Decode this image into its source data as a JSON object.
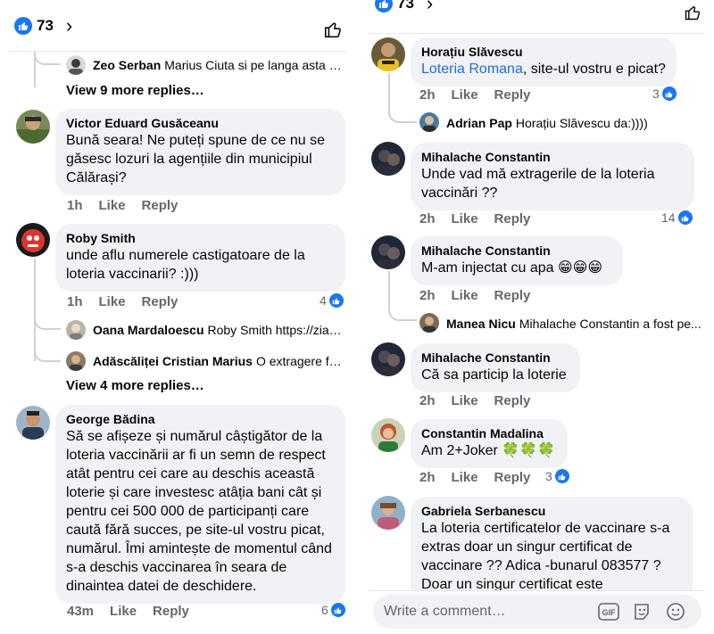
{
  "left": {
    "header": {
      "reaction_count": "73"
    },
    "threads": {
      "top_reply": {
        "author": "Zeo Serban",
        "text": "Marius Ciuta si pe langa asta fi..."
      },
      "top_view_more": "View 9 more replies…"
    },
    "comments": [
      {
        "author": "Victor Eduard Gusăceanu",
        "text": "Bună seara! Ne puteți spune de ce nu se găsesc lozuri la agențiile din municipiul Călărași?",
        "time": "1h",
        "like": "Like",
        "reply": "Reply"
      },
      {
        "author": "Roby Smith",
        "text": "unde aflu numerele castigatoare de la loteria vaccinarii? :)))",
        "time": "1h",
        "like": "Like",
        "reply": "Reply",
        "reactions": "4",
        "replies": [
          {
            "author": "Oana Mardaloescu",
            "text": "Roby Smith https://ziar..."
          },
          {
            "author": "Adăscăliței Cristian Marius",
            "text": "O extragere fa..."
          }
        ],
        "view_more": "View 4 more replies…"
      },
      {
        "author": "George Bădina",
        "text": "Să se afișeze și numărul câștigător de la loteria vaccinării ar fi un semn de respect atât pentru cei care au deschis această loterie și care investesc atâția bani cât și pentru cei 500 000 de participanți care caută fără succes, pe site-ul vostru picat, numărul. Îmi amintește de momentul când s-a deschis vaccinarea în seara de dinaintea datei de deschidere.",
        "time": "43m",
        "like": "Like",
        "reply": "Reply",
        "reactions": "6"
      }
    ]
  },
  "right": {
    "header": {
      "reaction_count": "73"
    },
    "comments": [
      {
        "author": "Horațiu Slăvescu",
        "link_text": "Loteria Romana",
        "text": ", site-ul vostru e picat?",
        "time": "2h",
        "like": "Like",
        "reply": "Reply",
        "reactions": "3",
        "replies": [
          {
            "author": "Adrian Pap",
            "text": "Horațiu Slăvescu da:))))"
          }
        ]
      },
      {
        "author": "Mihalache Constantin",
        "text": "Unde vad mă extragerile de la loteria vaccinări ??",
        "time": "2h",
        "like": "Like",
        "reply": "Reply",
        "reactions": "14"
      },
      {
        "author": "Mihalache Constantin",
        "text": "M-am injectat cu apa 😁😁😁",
        "time": "2h",
        "like": "Like",
        "reply": "Reply",
        "replies": [
          {
            "author": "Manea Nicu",
            "text": "Mihalache Constantin a fost pe..."
          }
        ]
      },
      {
        "author": "Mihalache Constantin",
        "text": "Că sa particip la loterie",
        "time": "2h",
        "like": "Like",
        "reply": "Reply"
      },
      {
        "author": "Constantin Madalina",
        "text": "Am 2+Joker 🍀🍀🍀",
        "time": "2h",
        "like": "Like",
        "reply": "Reply",
        "reactions": "3"
      },
      {
        "author": "Gabriela Serbanescu",
        "text": "La loteria certificatelor de vaccinare s-a extras doar un singur certificat de vaccinare ?? Adica -bunarul 083577 ? Doar un singur certificat este"
      }
    ],
    "composer": {
      "placeholder": "Write a comment…",
      "gif_label": "GIF"
    }
  },
  "colors": {
    "accent": "#1877f2",
    "bubble": "#f0f2f5",
    "meta": "#65676b",
    "link": "#216fdb"
  }
}
